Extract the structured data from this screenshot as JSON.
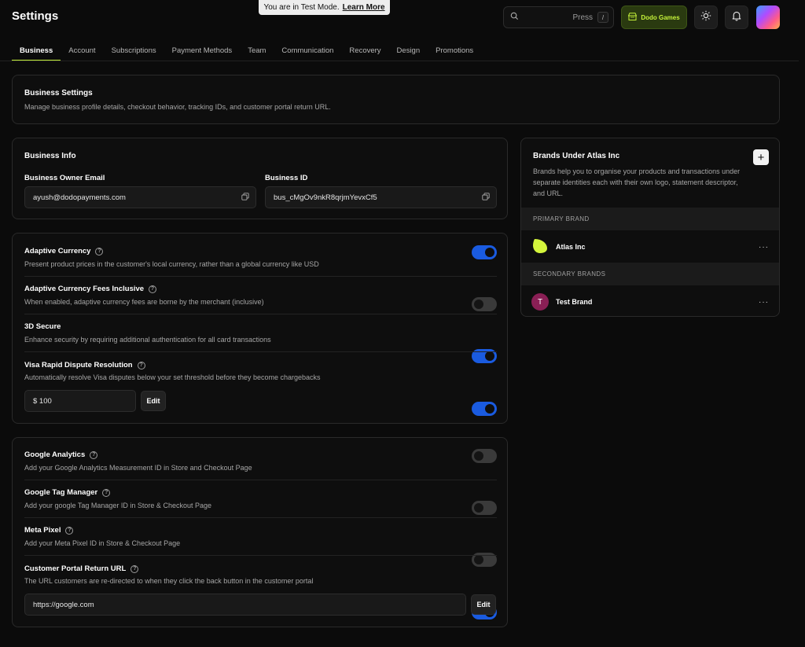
{
  "header": {
    "title": "Settings",
    "banner_text": "You are in Test Mode.",
    "banner_link": "Learn More",
    "search_hint": "Press",
    "search_key": "/",
    "store_name": "Dodo Games",
    "icons": [
      "search-icon",
      "store-icon",
      "sun-icon",
      "bell-icon"
    ]
  },
  "tabs": [
    "Business",
    "Account",
    "Subscriptions",
    "Payment Methods",
    "Team",
    "Communication",
    "Recovery",
    "Design",
    "Promotions"
  ],
  "business_settings": {
    "title": "Business Settings",
    "description": "Manage business profile details, checkout behavior, tracking IDs, and customer portal return URL."
  },
  "business_info": {
    "title": "Business Info",
    "owner_email_label": "Business Owner Email",
    "owner_email": "ayush@dodopayments.com",
    "business_id_label": "Business ID",
    "business_id": "bus_cMgOv9nkR8qrjmYevxCf5"
  },
  "currency_settings": [
    {
      "label": "Adaptive Currency",
      "help": true,
      "description": "Present product prices in the customer's local currency, rather than a global currency like USD",
      "enabled": true
    },
    {
      "label": "Adaptive Currency Fees Inclusive",
      "help": true,
      "description": "When enabled, adaptive currency fees are borne by the merchant (inclusive)",
      "enabled": false
    },
    {
      "label": "3D Secure",
      "help": false,
      "description": "Enhance security by requiring additional authentication for all card transactions",
      "enabled": true
    },
    {
      "label": "Visa Rapid Dispute Resolution",
      "help": true,
      "description": "Automatically resolve Visa disputes below your set threshold before they become chargebacks",
      "enabled": true
    }
  ],
  "dispute_threshold": "$ 100",
  "edit_label": "Edit",
  "tracking_settings": [
    {
      "label": "Google Analytics",
      "description": "Add your Google Analytics Measurement ID in Store and Checkout Page",
      "enabled": false
    },
    {
      "label": "Google Tag Manager",
      "description": "Add your google Tag Manager ID in Store & Checkout Page",
      "enabled": false
    },
    {
      "label": "Meta Pixel",
      "description": "Add your Meta Pixel ID in Store & Checkout Page",
      "enabled": false
    },
    {
      "label": "Customer Portal Return URL",
      "description": "The URL customers are re-directed to when they click the back button in the customer portal",
      "enabled": true
    }
  ],
  "return_url": "https://google.com",
  "brands": {
    "title": "Brands Under Atlas Inc",
    "description": "Brands help you to organise your products and transactions under separate identities each with their own logo, statement descriptor, and URL.",
    "primary_label": "PRIMARY BRAND",
    "primary": {
      "name": "Atlas Inc",
      "logo_color": "#d4f53c"
    },
    "secondary_label": "SECONDARY BRANDS",
    "secondary": [
      {
        "name": "Test Brand",
        "initial": "T",
        "avatar_color": "#8a1f55"
      }
    ],
    "more_label": "···",
    "add_label": "+"
  },
  "colors": {
    "accent": "#c5f23a",
    "toggle_on": "#1a5be0",
    "background": "#0b0b0b"
  }
}
